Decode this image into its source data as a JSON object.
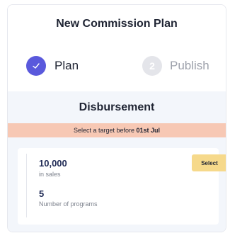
{
  "modal": {
    "title": "New Commission Plan"
  },
  "steps": [
    {
      "number": "1",
      "label": "Plan",
      "state": "completed",
      "icon": "check-icon"
    },
    {
      "number": "2",
      "label": "Publish",
      "state": "inactive"
    }
  ],
  "disbursement": {
    "title": "Disbursement",
    "notice_prefix": "Select a target  before ",
    "notice_date": "01st Jul",
    "target": {
      "sales_value": "10,000",
      "sales_label": "in sales",
      "programs_value": "5",
      "programs_label": "Number of programs",
      "select_label": "Select"
    }
  },
  "colors": {
    "accent": "#5a59dc",
    "notice_bg": "#f7c8b4",
    "select_button_bg": "#f6d98b"
  }
}
